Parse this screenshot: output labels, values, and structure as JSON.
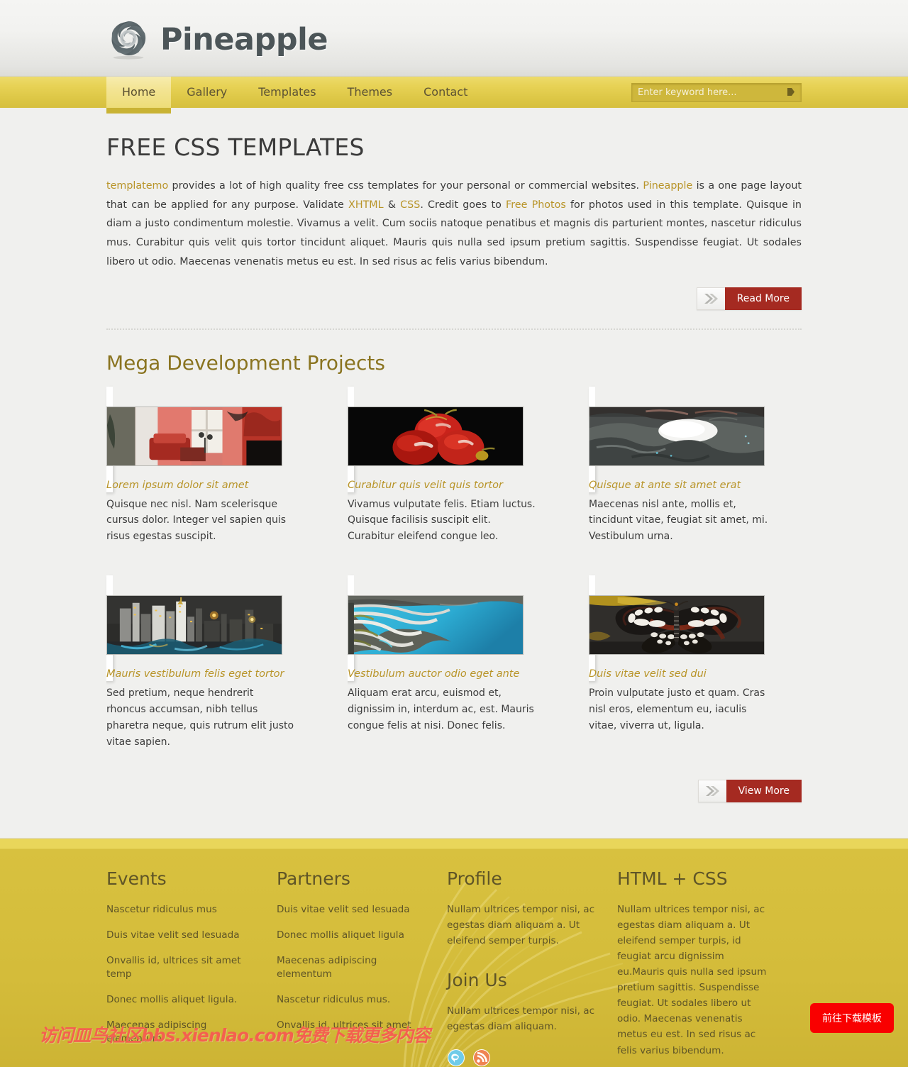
{
  "site": {
    "logo_text": "Pineapple",
    "logo_icon": "spiral-aperture-icon"
  },
  "nav": {
    "items": [
      {
        "label": "Home",
        "active": true
      },
      {
        "label": "Gallery",
        "active": false
      },
      {
        "label": "Templates",
        "active": false
      },
      {
        "label": "Themes",
        "active": false
      },
      {
        "label": "Contact",
        "active": false
      }
    ]
  },
  "search": {
    "placeholder": "Enter keyword here...",
    "value": "",
    "button_icon": "arrow-right-icon"
  },
  "main": {
    "page_title": "FREE CSS TEMPLATES",
    "intro_parts": [
      {
        "text": "templatemo",
        "link": true
      },
      {
        "text": " provides a lot of high quality free css templates for your personal or commercial websites. ",
        "link": false
      },
      {
        "text": "Pineapple",
        "link": true
      },
      {
        "text": " is a one page layout that can be applied for any purpose. Validate ",
        "link": false
      },
      {
        "text": "XHTML",
        "link": true
      },
      {
        "text": " & ",
        "link": false
      },
      {
        "text": "CSS",
        "link": true
      },
      {
        "text": ". Credit goes to ",
        "link": false
      },
      {
        "text": "Free Photos",
        "link": true
      },
      {
        "text": " for photos used in this template. Quisque in diam a justo condimentum molestie. Vivamus a velit. Cum sociis natoque penatibus et magnis dis parturient montes, nascetur ridiculus mus. Curabitur quis velit quis tortor tincidunt aliquet. Mauris quis nulla sed ipsum pretium sagittis. Suspendisse feugiat. Ut sodales libero ut odio. Maecenas venenatis metus eu est. In sed risus ac felis varius bibendum.",
        "link": false
      }
    ],
    "read_more_label": "Read More",
    "section_title": "Mega Development Projects",
    "view_more_label": "View More",
    "projects": [
      {
        "title": "Lorem ipsum dolor sit amet",
        "text": "Quisque nec nisl. Nam scelerisque cursus dolor. Integer vel sapien quis risus egestas suscipit.",
        "image_name": "red-living-room-photo"
      },
      {
        "title": "Curabitur quis velit quis tortor",
        "text": "Vivamus vulputate felis. Etiam luctus. Quisque facilisis suscipit elit. Curabitur eleifend congue leo.",
        "image_name": "red-apples-on-black-photo"
      },
      {
        "title": "Quisque at ante sit amet erat",
        "text": "Maecenas nisl ante, mollis et, tincidunt vitae, feugiat sit amet, mi. Vestibulum urna.",
        "image_name": "grey-rocky-landscape-photo"
      },
      {
        "title": "Mauris vestibulum felis eget tortor",
        "text": "Sed pretium, neque hendrerit rhoncus accumsan, nibh tellus pharetra neque, quis rutrum elit justo vitae sapien.",
        "image_name": "night-city-skyline-photo"
      },
      {
        "title": "Vestibulum auctor odio eget ante",
        "text": "Aliquam erat arcu, euismod et, dignissim in, interdum ac, est. Mauris congue felis at nisi. Donec felis.",
        "image_name": "coastline-aerial-photo"
      },
      {
        "title": "Duis vitae velit sed dui",
        "text": "Proin vulputate justo et quam. Cras nisl eros, elementum eu, iaculis vitae, viverra ut, ligula.",
        "image_name": "butterfly-photo"
      }
    ]
  },
  "footer": {
    "events": {
      "title": "Events",
      "items": [
        "Nascetur ridiculus mus",
        "Duis vitae velit sed lesuada",
        "Onvallis id, ultrices sit amet temp",
        "Donec mollis aliquet ligula.",
        "Maecenas adipiscing elementum"
      ]
    },
    "partners": {
      "title": "Partners",
      "items": [
        "Duis vitae velit sed lesuada",
        "Donec mollis aliquet ligula",
        "Maecenas adipiscing elementum",
        "Nascetur ridiculus mus.",
        "Onvallis id, ultrices sit amet"
      ]
    },
    "profile": {
      "title": "Profile",
      "text": "Nullam ultrices tempor nisi, ac egestas diam aliquam a. Ut eleifend semper turpis."
    },
    "join_us": {
      "title": "Join Us",
      "text": "Nullam ultrices tempor nisi, ac egestas diam aliquam.",
      "social": [
        {
          "name": "twitter-icon",
          "color": "#62c8e8"
        },
        {
          "name": "rss-icon",
          "color": "#ef7f4a"
        }
      ]
    },
    "htmlcss": {
      "title": "HTML + CSS",
      "text": "Nullam ultrices tempor nisi, ac egestas diam aliquam a. Ut eleifend semper turpis, id feugiat arcu dignissim eu.Mauris quis nulla sed ipsum pretium sagittis. Suspendisse feugiat. Ut sodales libero ut odio. Maecenas venenatis metus eu est. In sed risus ac felis varius bibendum."
    }
  },
  "overlay": {
    "watermark_text": "访问皿鸟社区bbs.xienlao.com免费下载更多内容",
    "download_button_label": "前往下载模板"
  },
  "colors": {
    "nav_yellow": "#ddc746",
    "footer_yellow": "#d4bc3a",
    "link_gold": "#b89428",
    "button_red": "#a52a21",
    "heading_olive": "#8a7420",
    "overlay_red": "#f90000"
  }
}
